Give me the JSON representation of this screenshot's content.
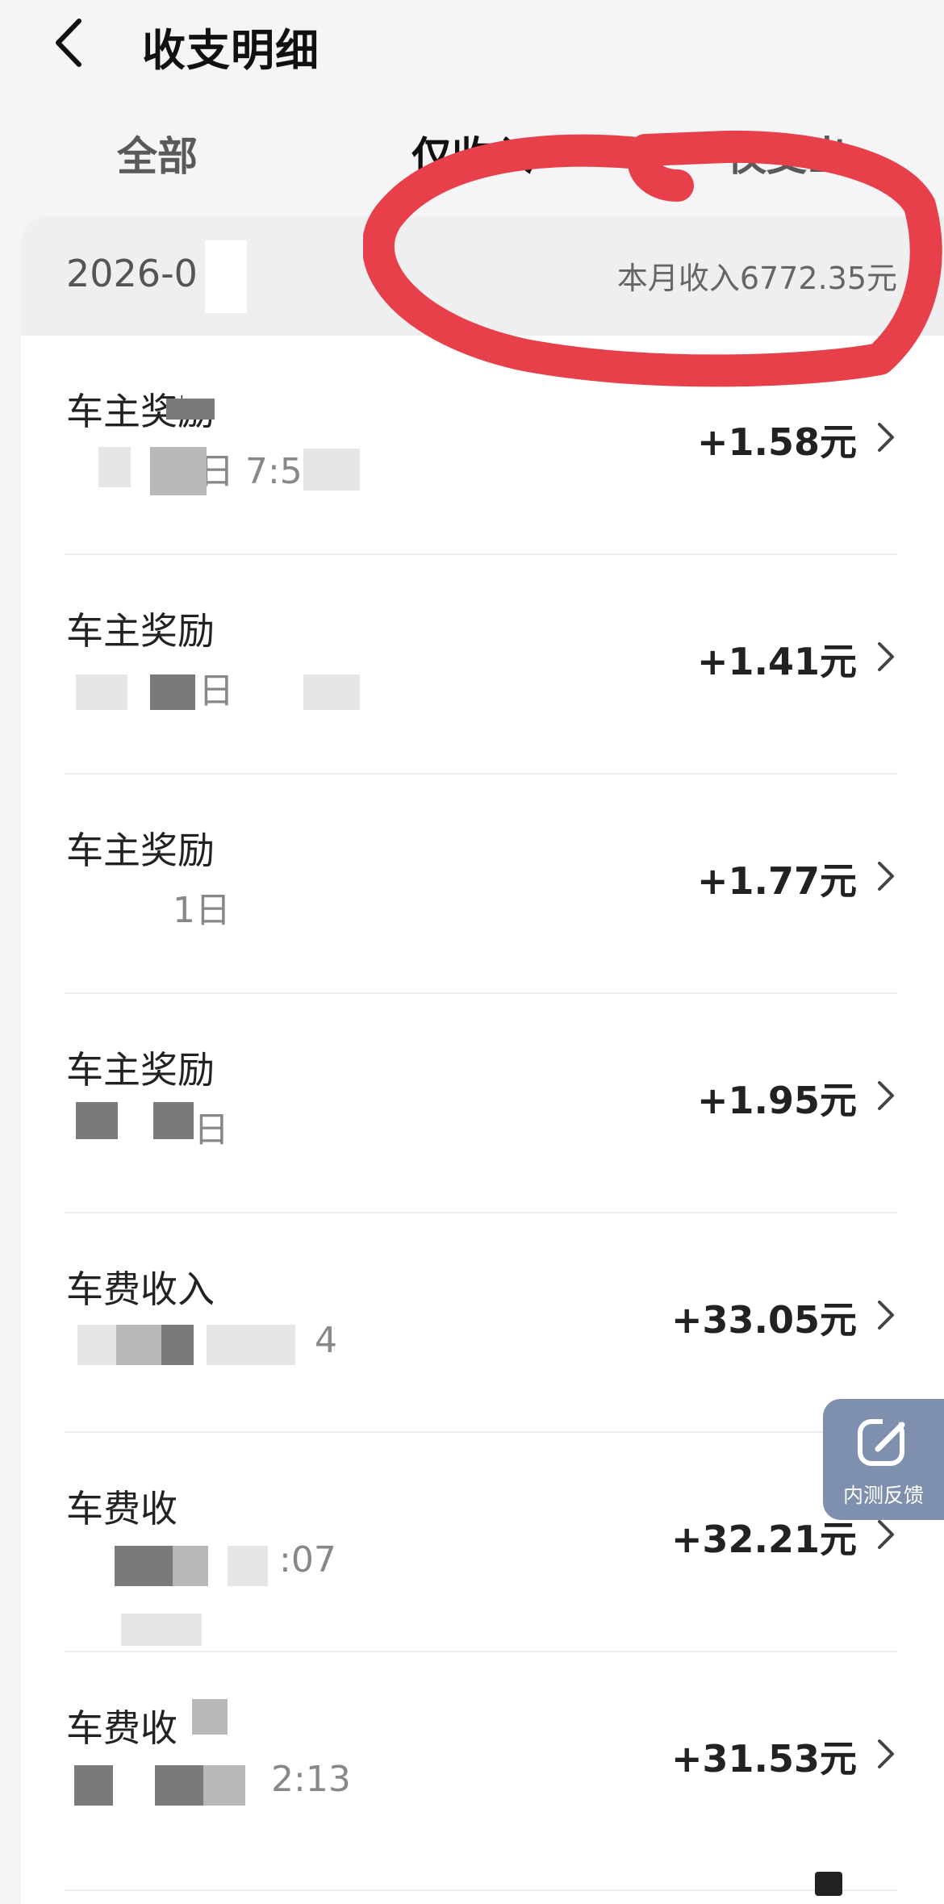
{
  "header": {
    "title": "收支明细"
  },
  "tabs": [
    {
      "label": "全部",
      "active": false
    },
    {
      "label": "仅收入",
      "active": true
    },
    {
      "label": "仅支出",
      "active": false
    }
  ],
  "summary": {
    "month": "2026-0",
    "income": "本月收入6772.35元"
  },
  "rows": [
    {
      "name": "车主奖励",
      "time": "日 7:5",
      "amount": "+1.58元"
    },
    {
      "name": "车主奖励",
      "time": "日",
      "amount": "+1.41元"
    },
    {
      "name": "车主奖励",
      "time": "1日",
      "amount": "+1.77元"
    },
    {
      "name": "车主奖励",
      "time": "日",
      "amount": "+1.95元"
    },
    {
      "name": "车费收入",
      "time": "4",
      "amount": "+33.05元"
    },
    {
      "name": "车费收",
      "time": ":07",
      "amount": "+32.21元"
    },
    {
      "name": "车费收",
      "time": "2:13",
      "amount": "+31.53元"
    }
  ],
  "feedback": {
    "label": "内测反馈"
  },
  "colors": {
    "annotation": "#e8404a",
    "feedback": "#7f8fae"
  }
}
